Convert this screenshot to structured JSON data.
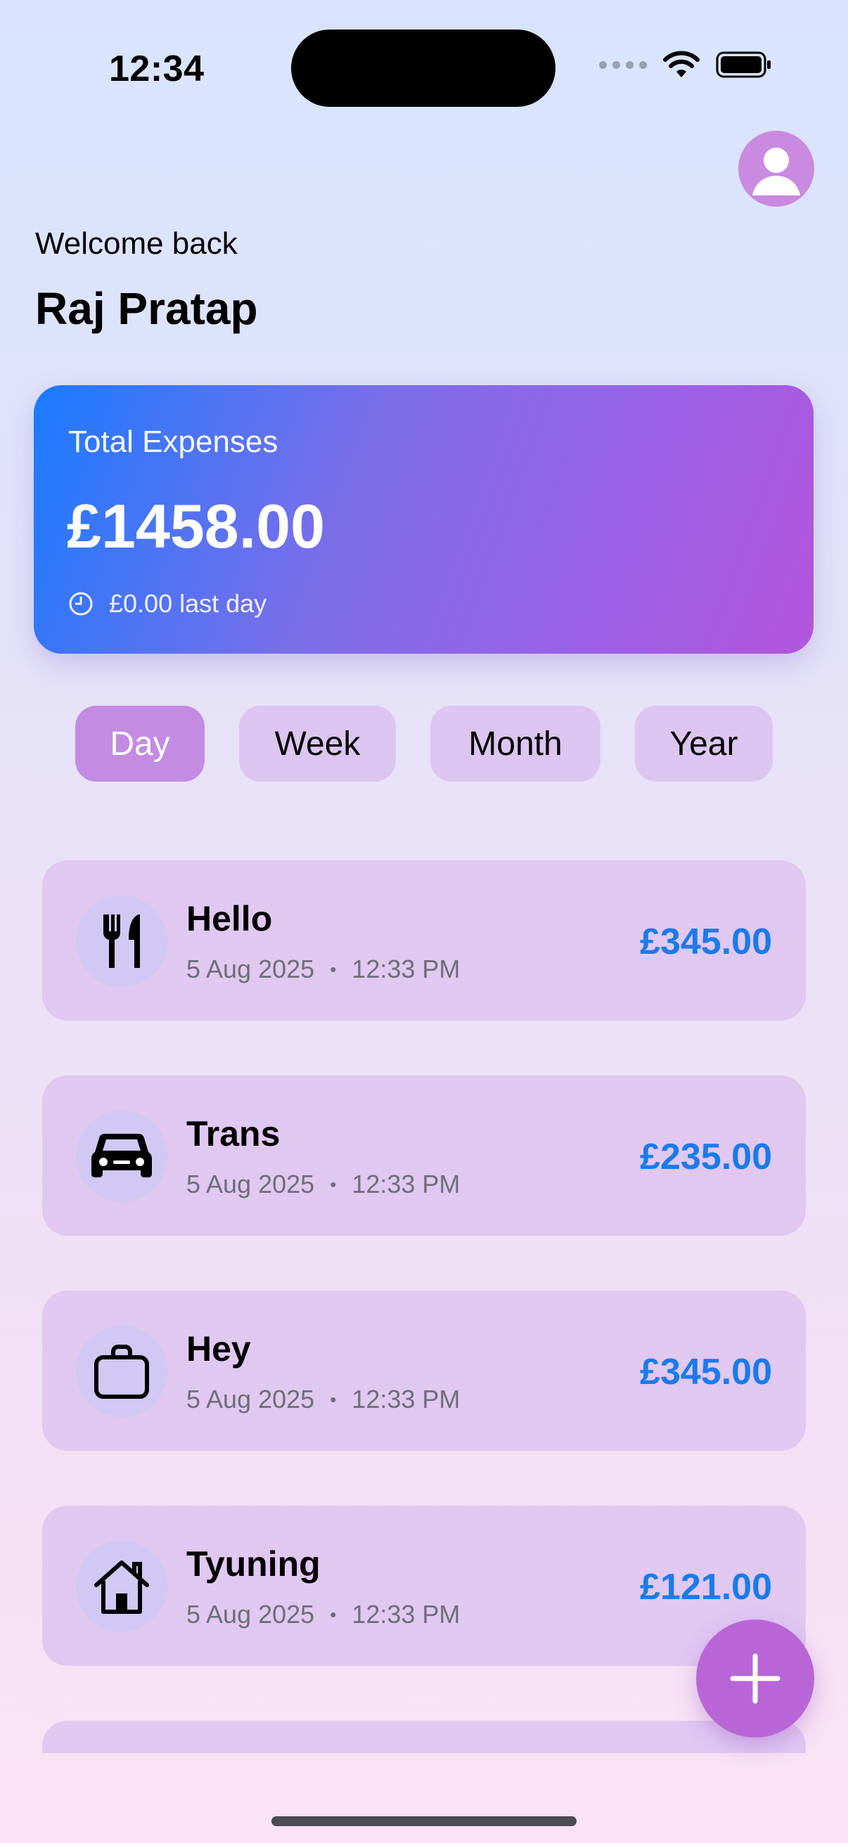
{
  "status_bar": {
    "time": "12:34"
  },
  "header": {
    "welcome": "Welcome back",
    "user_name": "Raj Pratap"
  },
  "summary": {
    "label": "Total Expenses",
    "total": "£1458.00",
    "last_day": "£0.00 last day"
  },
  "filters": [
    {
      "label": "Day",
      "active": true
    },
    {
      "label": "Week",
      "active": false
    },
    {
      "label": "Month",
      "active": false
    },
    {
      "label": "Year",
      "active": false
    }
  ],
  "transactions": [
    {
      "title": "Hello",
      "date": "5 Aug 2025",
      "time": "12:33 PM",
      "amount": "£345.00",
      "icon": "fork-knife-icon"
    },
    {
      "title": "Trans",
      "date": "5 Aug 2025",
      "time": "12:33 PM",
      "amount": "£235.00",
      "icon": "car-icon"
    },
    {
      "title": "Hey",
      "date": "5 Aug 2025",
      "time": "12:33 PM",
      "amount": "£345.00",
      "icon": "bag-icon"
    },
    {
      "title": "Tyuning",
      "date": "5 Aug 2025",
      "time": "12:33 PM",
      "amount": "£121.00",
      "icon": "house-icon"
    }
  ],
  "colors": {
    "accent_blue": "#1a7bea",
    "active_pill": "#c38be2",
    "fab": "#b866d6"
  }
}
